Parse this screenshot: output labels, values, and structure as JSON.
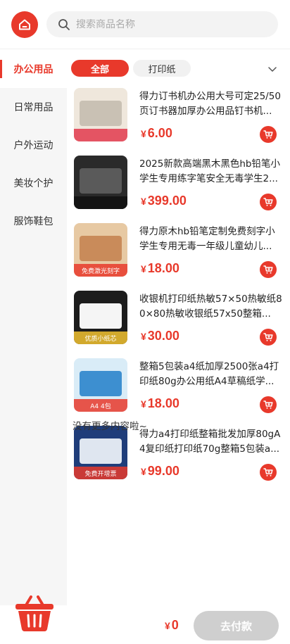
{
  "header": {
    "home_icon": "home-icon",
    "search_icon": "search-icon",
    "search_placeholder": "搜索商品名称",
    "search_value": ""
  },
  "colors": {
    "accent": "#e8392b",
    "sidebar_bg": "#f6f6f6",
    "disabled": "#cfcfcf"
  },
  "sidebar": {
    "items": [
      {
        "label": "办公用品",
        "active": true
      },
      {
        "label": "日常用品",
        "active": false
      },
      {
        "label": "户外运动",
        "active": false
      },
      {
        "label": "美妆个护",
        "active": false
      },
      {
        "label": "服饰鞋包",
        "active": false
      }
    ]
  },
  "tabs": {
    "items": [
      {
        "label": "全部",
        "active": true
      },
      {
        "label": "打印纸",
        "active": false
      }
    ],
    "expand_icon": "chevron-down-icon"
  },
  "products": [
    {
      "title": "得力订书机办公用大号可定25/50页订书器加厚办公用品钉书机...",
      "price": "6.00",
      "thumb_text": "",
      "thumb_colors": [
        "#efe7dc",
        "#c9c1b4",
        "#e23a4e"
      ]
    },
    {
      "title": "2025新款高端黑木黑色hb铅笔小学生专用练字笔安全无毒学生2...",
      "price": "399.00",
      "thumb_text": "",
      "thumb_colors": [
        "#2a2a2a",
        "#5a5a5a",
        "#111111"
      ]
    },
    {
      "title": "得力原木hb铅笔定制免费刻字小学生专用无毒一年级儿童幼儿...",
      "price": "18.00",
      "thumb_text": "免费激光刻字",
      "thumb_colors": [
        "#e7c9a3",
        "#c98b5a",
        "#e8392b"
      ]
    },
    {
      "title": "收银机打印纸热敏57×50热敏纸80×80热敏收银纸57x50整箱...",
      "price": "30.00",
      "thumb_text": "优质小纸芯",
      "thumb_colors": [
        "#1c1c1c",
        "#f5f5f5",
        "#f2c230"
      ]
    },
    {
      "title": "整箱5包装a4纸加厚2500张a4打印纸80g办公用纸A4草稿纸学...",
      "price": "18.00",
      "thumb_text": "A4 4包",
      "thumb_colors": [
        "#d9ecf7",
        "#3d8fd0",
        "#e8392b"
      ]
    },
    {
      "title": "得力a4打印纸整箱批发加厚80gA4复印纸打印纸70g整箱5包装a...",
      "price": "99.00",
      "thumb_text": "免费开增票",
      "thumb_colors": [
        "#1f3d7a",
        "#dfe6f0",
        "#e8392b"
      ]
    }
  ],
  "currency_symbol": "¥",
  "cart_icon": "add-to-cart-icon",
  "list_end_text": "没有更多内容啦~",
  "footer": {
    "basket_icon": "shopping-basket-icon",
    "total": "0",
    "checkout_label": "去付款"
  }
}
